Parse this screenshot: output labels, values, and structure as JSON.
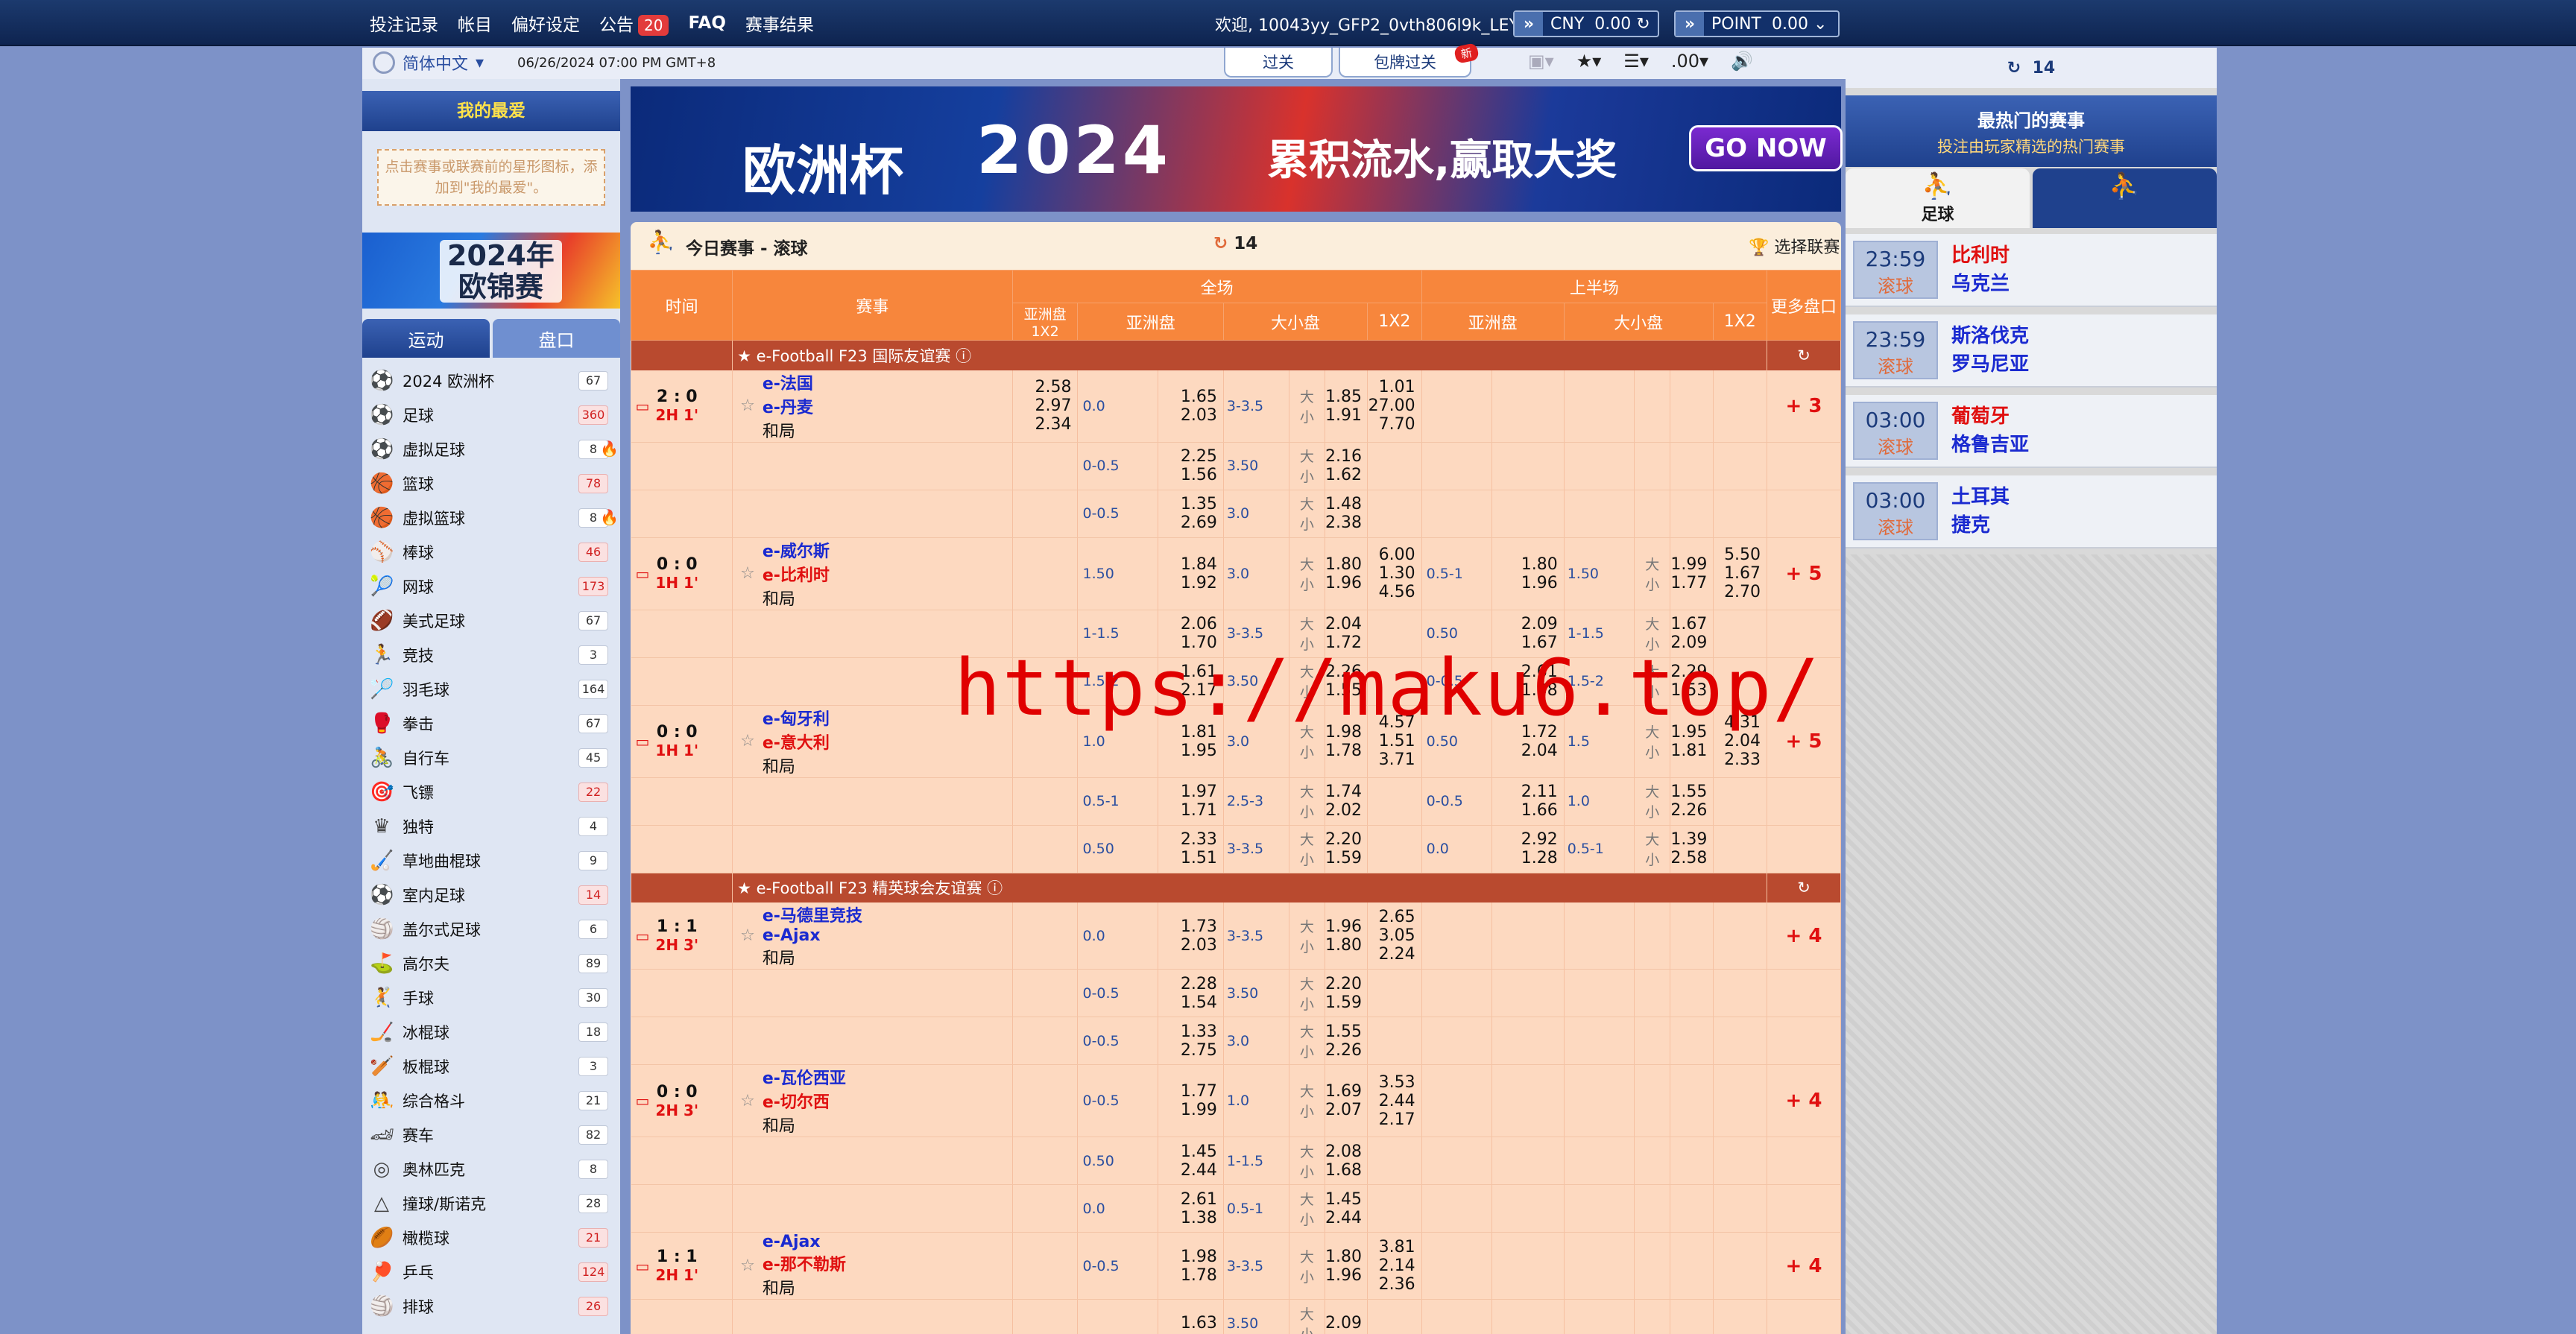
{
  "topmenu": {
    "items": [
      "投注记录",
      "帐目",
      "偏好设定",
      "公告",
      "FAQ",
      "赛事结果"
    ],
    "notice_count": "20"
  },
  "welcome": "欢迎, 10043yy_GFP2_0vth806l9k_LEY",
  "currency": {
    "label": "CNY",
    "value": "0.00"
  },
  "point": {
    "label": "POINT",
    "value": "0.00"
  },
  "lang": "简体中文",
  "datetime": "06/26/2024 07:00 PM GMT+8",
  "tabs": {
    "parlay": "过关",
    "bundle": "包牌过关",
    "new": "新"
  },
  "tools": {
    "odds_format": ".00"
  },
  "fav": {
    "title": "我的最爱",
    "hint": "点击赛事或联赛前的星形图标，添加到\"我的最爱\"。"
  },
  "euro": {
    "line1": "2024年",
    "line2": "欧锦赛"
  },
  "sporttabs": {
    "sport": "运动",
    "market": "盘口"
  },
  "sports": [
    {
      "icon": "⚽",
      "name": "2024 欧洲杯",
      "count": "67",
      "hot": false,
      "red": false
    },
    {
      "icon": "⚽",
      "name": "足球",
      "count": "360",
      "hot": false,
      "red": true
    },
    {
      "icon": "⚽",
      "name": "虚拟足球",
      "count": "8",
      "hot": true,
      "red": false
    },
    {
      "icon": "🏀",
      "name": "篮球",
      "count": "78",
      "hot": false,
      "red": true
    },
    {
      "icon": "🏀",
      "name": "虚拟篮球",
      "count": "8",
      "hot": true,
      "red": false
    },
    {
      "icon": "⚾",
      "name": "棒球",
      "count": "46",
      "hot": false,
      "red": true
    },
    {
      "icon": "🎾",
      "name": "网球",
      "count": "173",
      "hot": false,
      "red": true
    },
    {
      "icon": "🏈",
      "name": "美式足球",
      "count": "67",
      "hot": false,
      "red": false
    },
    {
      "icon": "🏃",
      "name": "竞技",
      "count": "3",
      "hot": false,
      "red": false
    },
    {
      "icon": "🏸",
      "name": "羽毛球",
      "count": "164",
      "hot": false,
      "red": false
    },
    {
      "icon": "🥊",
      "name": "拳击",
      "count": "67",
      "hot": false,
      "red": false
    },
    {
      "icon": "🚴",
      "name": "自行车",
      "count": "45",
      "hot": false,
      "red": false
    },
    {
      "icon": "🎯",
      "name": "飞镖",
      "count": "22",
      "hot": false,
      "red": true
    },
    {
      "icon": "♛",
      "name": "独特",
      "count": "4",
      "hot": false,
      "red": false
    },
    {
      "icon": "🏑",
      "name": "草地曲棍球",
      "count": "9",
      "hot": false,
      "red": false
    },
    {
      "icon": "⚽",
      "name": "室内足球",
      "count": "14",
      "hot": false,
      "red": true
    },
    {
      "icon": "🏐",
      "name": "盖尔式足球",
      "count": "6",
      "hot": false,
      "red": false
    },
    {
      "icon": "⛳",
      "name": "高尔夫",
      "count": "89",
      "hot": false,
      "red": false
    },
    {
      "icon": "🤾",
      "name": "手球",
      "count": "30",
      "hot": false,
      "red": false
    },
    {
      "icon": "🏒",
      "name": "冰棍球",
      "count": "18",
      "hot": false,
      "red": false
    },
    {
      "icon": "🏏",
      "name": "板棍球",
      "count": "3",
      "hot": false,
      "red": false
    },
    {
      "icon": "🤼",
      "name": "综合格斗",
      "count": "21",
      "hot": false,
      "red": false
    },
    {
      "icon": "🏎",
      "name": "赛车",
      "count": "82",
      "hot": false,
      "red": false
    },
    {
      "icon": "◎",
      "name": "奥林匹克",
      "count": "8",
      "hot": false,
      "red": false
    },
    {
      "icon": "△",
      "name": "撞球/斯诺克",
      "count": "28",
      "hot": false,
      "red": false
    },
    {
      "icon": "🏉",
      "name": "橄榄球",
      "count": "21",
      "hot": false,
      "red": true
    },
    {
      "icon": "🏓",
      "name": "乒乓",
      "count": "124",
      "hot": false,
      "red": true
    },
    {
      "icon": "🏐",
      "name": "排球",
      "count": "26",
      "hot": false,
      "red": true
    }
  ],
  "banner": {
    "big": "2024",
    "slogan": "累积流水,赢取大奖",
    "cta": "GO NOW",
    "left": "欧洲杯"
  },
  "live": {
    "title": "今日赛事 - 滚球",
    "count": "14",
    "select": "选择联赛"
  },
  "table": {
    "h_time": "时间",
    "h_match": "赛事",
    "h_full": "全场",
    "h_half": "上半场",
    "h_more": "更多盘口",
    "h_ah1x2": "亚洲盘 1X2",
    "h_ah": "亚洲盘",
    "h_ou": "大小盘",
    "h_1x2": "1X2",
    "league1": "e-Football F23 国际友谊赛",
    "league2": "e-Football F23 精英球会友谊赛",
    "draw": "和局",
    "big": "大",
    "small": "小",
    "matches": [
      {
        "score": "2 : 0",
        "time": "2H 1'",
        "home": "e-法国",
        "away": "e-丹麦",
        "homeRed": false,
        "awayRed": false,
        "a1": "2.58",
        "a2": "2.97",
        "a3": "2.34",
        "lines": [
          [
            "0.0",
            "1.65",
            "2.03",
            "3-3.5",
            "1.85",
            "1.91",
            "1.01",
            "27.00",
            "7.70"
          ],
          [
            "0-0.5",
            "2.25",
            "1.56",
            "3.50",
            "2.16",
            "1.62",
            "",
            "",
            ""
          ],
          [
            "0-0.5",
            "1.35",
            "2.69",
            "3.0",
            "1.48",
            "2.38",
            "",
            "",
            ""
          ]
        ],
        "half": [],
        "more": "+ 3"
      },
      {
        "score": "0 : 0",
        "time": "1H 1'",
        "home": "e-威尔斯",
        "away": "e-比利时",
        "homeRed": false,
        "awayRed": true,
        "a1": "",
        "a2": "",
        "a3": "",
        "lines": [
          [
            "1.50",
            "1.84",
            "1.92",
            "3.0",
            "1.80",
            "1.96",
            "6.00",
            "1.30",
            "4.56"
          ],
          [
            "1-1.5",
            "2.06",
            "1.70",
            "3-3.5",
            "2.04",
            "1.72",
            "",
            "",
            ""
          ],
          [
            "1.5-2",
            "1.61",
            "2.17",
            "3.50",
            "2.26",
            "1.55",
            "",
            "",
            ""
          ]
        ],
        "half": [
          [
            "0.5-1",
            "1.80",
            "1.96",
            "1.50",
            "1.99",
            "1.77",
            "5.50",
            "1.67",
            "2.70"
          ],
          [
            "0.50",
            "2.09",
            "1.67",
            "1-1.5",
            "1.67",
            "2.09",
            "",
            "",
            ""
          ],
          [
            "0-0.5",
            "2.61",
            "1.38",
            "1.5-2",
            "2.29",
            "1.53",
            "",
            "",
            ""
          ]
        ],
        "more": "+ 5"
      },
      {
        "score": "0 : 0",
        "time": "1H 1'",
        "home": "e-匈牙利",
        "away": "e-意大利",
        "homeRed": false,
        "awayRed": true,
        "a1": "",
        "a2": "",
        "a3": "",
        "lines": [
          [
            "1.0",
            "1.81",
            "1.95",
            "3.0",
            "1.98",
            "1.78",
            "4.57",
            "1.51",
            "3.71"
          ],
          [
            "0.5-1",
            "1.97",
            "1.71",
            "2.5-3",
            "1.74",
            "2.02",
            "",
            "",
            ""
          ],
          [
            "0.50",
            "2.33",
            "1.51",
            "3-3.5",
            "2.20",
            "1.59",
            "",
            "",
            ""
          ]
        ],
        "half": [
          [
            "0.50",
            "1.72",
            "2.04",
            "1.5",
            "1.95",
            "1.81",
            "4.31",
            "2.04",
            "2.33"
          ],
          [
            "0-0.5",
            "2.11",
            "1.66",
            "1.0",
            "1.55",
            "2.26",
            "",
            "",
            ""
          ],
          [
            "0.0",
            "2.92",
            "1.28",
            "0.5-1",
            "1.39",
            "2.58",
            "",
            "",
            ""
          ]
        ],
        "more": "+ 5"
      },
      {
        "score": "1 : 1",
        "time": "2H 3'",
        "home": "e-马德里竞技",
        "away": "e-Ajax",
        "homeRed": false,
        "awayRed": false,
        "a1": "",
        "a2": "",
        "a3": "",
        "lines": [
          [
            "0.0",
            "1.73",
            "2.03",
            "3-3.5",
            "1.96",
            "1.80",
            "2.65",
            "3.05",
            "2.24"
          ],
          [
            "0-0.5",
            "2.28",
            "1.54",
            "3.50",
            "2.20",
            "1.59",
            "",
            "",
            ""
          ],
          [
            "0-0.5",
            "1.33",
            "2.75",
            "3.0",
            "1.55",
            "2.26",
            "",
            "",
            ""
          ]
        ],
        "half": [],
        "more": "+ 4"
      },
      {
        "score": "0 : 0",
        "time": "2H 3'",
        "home": "e-瓦伦西亚",
        "away": "e-切尔西",
        "homeRed": false,
        "awayRed": true,
        "a1": "",
        "a2": "",
        "a3": "",
        "lines": [
          [
            "0-0.5",
            "1.77",
            "1.99",
            "1.0",
            "1.69",
            "2.07",
            "3.53",
            "2.44",
            "2.17"
          ],
          [
            "0.50",
            "1.45",
            "2.44",
            "1-1.5",
            "2.08",
            "1.68",
            "",
            "",
            ""
          ],
          [
            "0.0",
            "2.61",
            "1.38",
            "0.5-1",
            "1.45",
            "2.44",
            "",
            "",
            ""
          ]
        ],
        "half": [],
        "more": "+ 4"
      },
      {
        "score": "1 : 1",
        "time": "2H 1'",
        "home": "e-Ajax",
        "away": "e-那不勒斯",
        "homeRed": false,
        "awayRed": true,
        "a1": "",
        "a2": "",
        "a3": "",
        "lines": [
          [
            "0-0.5",
            "1.98",
            "1.78",
            "3-3.5",
            "1.80",
            "1.96",
            "3.81",
            "2.14",
            "2.36"
          ],
          [
            "",
            "1.63",
            "",
            "3.50",
            "2.09",
            "",
            "",
            "",
            ""
          ]
        ],
        "half": [],
        "more": "+ 4"
      }
    ]
  },
  "right": {
    "refresh_count": "14",
    "title": "最热门的赛事",
    "subtitle": "投注由玩家精选的热门赛事",
    "tab_label": "足球",
    "live_label": "滚球",
    "hot": [
      {
        "time": "23:59",
        "home": "比利时",
        "away": "乌克兰",
        "homeRed": true
      },
      {
        "time": "23:59",
        "home": "斯洛伐克",
        "away": "罗马尼亚",
        "homeRed": false
      },
      {
        "time": "03:00",
        "home": "葡萄牙",
        "away": "格鲁吉亚",
        "homeRed": true
      },
      {
        "time": "03:00",
        "home": "土耳其",
        "away": "捷克",
        "homeRed": false
      }
    ]
  },
  "watermark": "https://maku6.top/",
  "colors": {
    "header": "#0e2450",
    "accent": "#f7863c",
    "league": "#b94a2f",
    "body": "#fdd9c0"
  }
}
